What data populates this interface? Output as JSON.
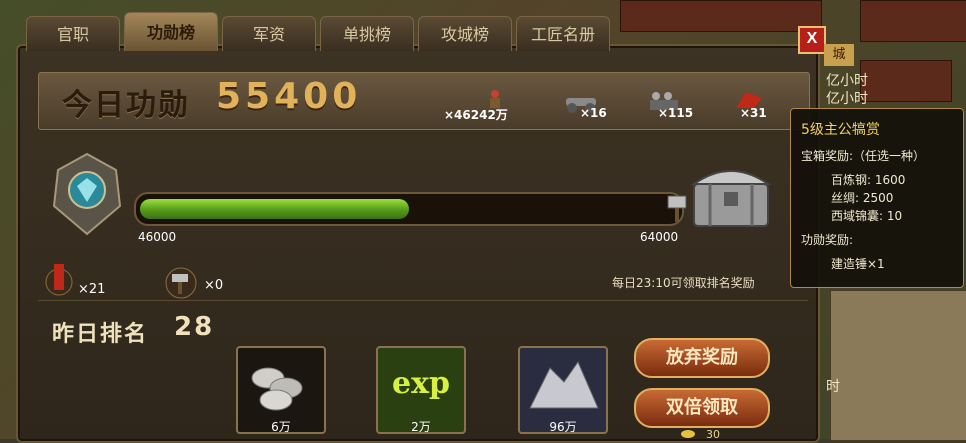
{
  "tabs": [
    "官职",
    "功勋榜",
    "军资",
    "单挑榜",
    "攻城榜",
    "工匠名册"
  ],
  "active_tab_index": 1,
  "close_label": "X",
  "city_label": "城",
  "side_texts": [
    "亿小时",
    "亿小时",
    "时"
  ],
  "today": {
    "label": "今日功勋",
    "value": "55400"
  },
  "resources": [
    {
      "icon": "soldier-icon",
      "count": "×46242万"
    },
    {
      "icon": "cannon-icon",
      "count": "×16"
    },
    {
      "icon": "troops-icon",
      "count": "×115"
    },
    {
      "icon": "flag-horse-icon",
      "count": "×31"
    }
  ],
  "progress": {
    "min": "46000",
    "max": "64000",
    "fraction": 0.5
  },
  "items": [
    {
      "icon": "banner-icon",
      "count": "×21"
    },
    {
      "icon": "hammer-icon",
      "count": "×0"
    }
  ],
  "notice": "每日23:10可领取排名奖励",
  "yesterday": {
    "label": "昨日排名",
    "value": "28"
  },
  "rewards": [
    {
      "icon": "silver-coins-icon",
      "amount": "6万"
    },
    {
      "icon": "exp-icon",
      "label": "exp",
      "amount": "2万"
    },
    {
      "icon": "ore-icon",
      "amount": "96万"
    }
  ],
  "buttons": {
    "abandon": "放弃奖励",
    "double": "双倍领取"
  },
  "gold_amount": "30",
  "tooltip": {
    "title": "5级主公犒赏",
    "chest_label": "宝箱奖励:（任选一种）",
    "chest_items": [
      "百炼钢: 1600",
      "丝绸: 2500",
      "西域锦囊: 10"
    ],
    "merit_label": "功勋奖励:",
    "merit_items": [
      "建造锤×1"
    ]
  }
}
